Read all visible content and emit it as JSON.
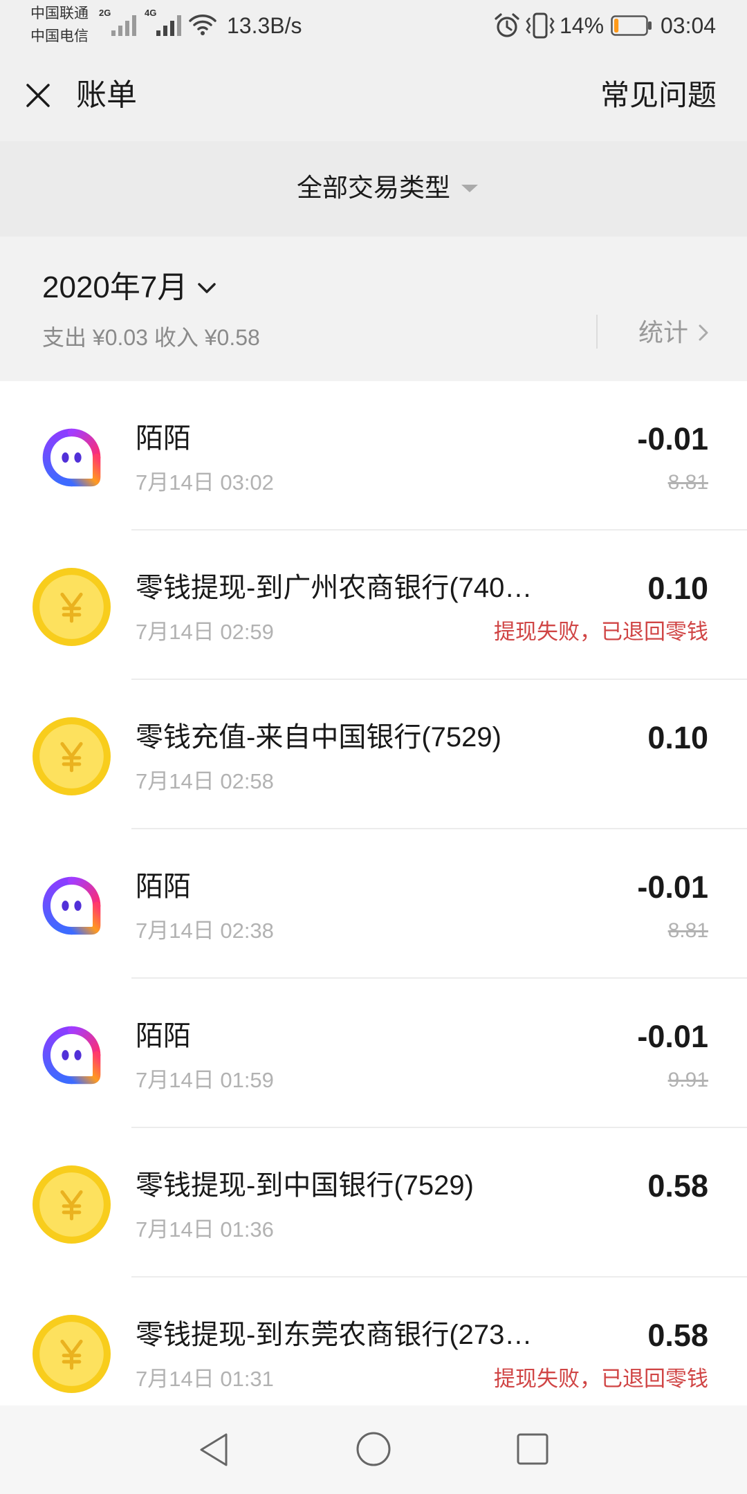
{
  "status_bar": {
    "carrier_top": "中国联通",
    "carrier_bottom": "中国电信",
    "network_1": "2G",
    "network_2": "4G",
    "speed": "13.3B/s",
    "battery": "14%",
    "time": "03:04",
    "icons": [
      "signal-icon",
      "wifi-icon",
      "alarm-icon",
      "vibrate-icon",
      "battery-icon"
    ]
  },
  "header": {
    "title": "账单",
    "help": "常见问题",
    "close_icon": "close-icon"
  },
  "filter": {
    "label": "全部交易类型",
    "icon": "caret-down-icon"
  },
  "month": {
    "label": "2020年7月",
    "summary": "支出 ¥0.03 收入 ¥0.58",
    "stats": "统计"
  },
  "transactions": [
    {
      "icon": "momo-icon",
      "title": "陌陌",
      "time": "7月14日 03:02",
      "amount": "-0.01",
      "balance": "8.81"
    },
    {
      "icon": "coin-icon",
      "title": "零钱提现-到广州农商银行(740…",
      "time": "7月14日 02:59",
      "amount": "0.10",
      "note": "提现失败，已退回零钱"
    },
    {
      "icon": "coin-icon",
      "title": "零钱充值-来自中国银行(7529)",
      "time": "7月14日 02:58",
      "amount": "0.10"
    },
    {
      "icon": "momo-icon",
      "title": "陌陌",
      "time": "7月14日 02:38",
      "amount": "-0.01",
      "balance": "8.81"
    },
    {
      "icon": "momo-icon",
      "title": "陌陌",
      "time": "7月14日 01:59",
      "amount": "-0.01",
      "balance": "9.91"
    },
    {
      "icon": "coin-icon",
      "title": "零钱提现-到中国银行(7529)",
      "time": "7月14日 01:36",
      "amount": "0.58"
    },
    {
      "icon": "coin-icon",
      "title": "零钱提现-到东莞农商银行(273…",
      "time": "7月14日 01:31",
      "amount": "0.58",
      "note": "提现失败，已退回零钱"
    }
  ],
  "nav_bar": {
    "icons": [
      "back-icon",
      "home-icon",
      "recents-icon"
    ]
  },
  "colors": {
    "page_bg": "#f2f2f2",
    "text": "#191919",
    "secondary_text": "#b2b2b2",
    "failure_red": "#d04545",
    "coin_yellow": "#f8cd1c",
    "battery_orange": "#ff9a1a"
  }
}
